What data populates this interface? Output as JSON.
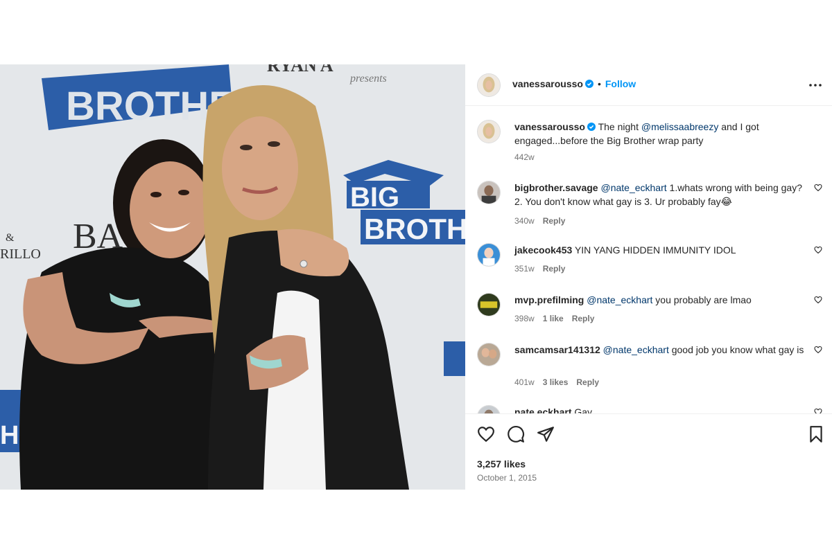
{
  "post": {
    "author": "vanessarousso",
    "follow_label": "Follow",
    "separator": "•",
    "more_icon": "more-horizontal-icon",
    "verified_color": "#0095f6"
  },
  "caption": {
    "author": "vanessarousso",
    "text_before": "The night ",
    "mention": "@melissaabreezy",
    "text_after": " and I got engaged...before the Big Brother wrap party",
    "time": "442w"
  },
  "comments": [
    {
      "author": "bigbrother.savage",
      "mention": "@nate_eckhart",
      "text": " 1.whats wrong with being gay? 2. You don't know what gay is 3. Ur probably fay😂",
      "time": "340w",
      "likes": "",
      "reply": "Reply"
    },
    {
      "author": "jakecook453",
      "mention": "",
      "text": "YIN YANG HIDDEN IMMUNITY IDOL",
      "time": "351w",
      "likes": "",
      "reply": "Reply"
    },
    {
      "author": "mvp.prefilming",
      "mention": "@nate_eckhart",
      "text": " you probably are lmao",
      "time": "398w",
      "likes": "1 like",
      "reply": "Reply"
    },
    {
      "author": "samcamsar141312",
      "mention": "@nate_eckhart",
      "text": " good job you know what gay is",
      "time": "401w",
      "likes": "3 likes",
      "reply": "Reply"
    },
    {
      "author": "nate.eckhart",
      "mention": "",
      "text": "Gay",
      "time": "",
      "likes": "",
      "reply": ""
    }
  ],
  "actions": {
    "like_icon": "heart-icon",
    "comment_icon": "comment-icon",
    "share_icon": "share-icon",
    "save_icon": "bookmark-icon"
  },
  "stats": {
    "likes": "3,257 likes",
    "date": "October 1, 2015"
  },
  "photo": {
    "backdrop_texts": [
      "BROTHER",
      "RYAN A",
      "presents",
      "BIG",
      "BROTHER",
      "BA",
      "&",
      "RILLO",
      "HER"
    ]
  }
}
